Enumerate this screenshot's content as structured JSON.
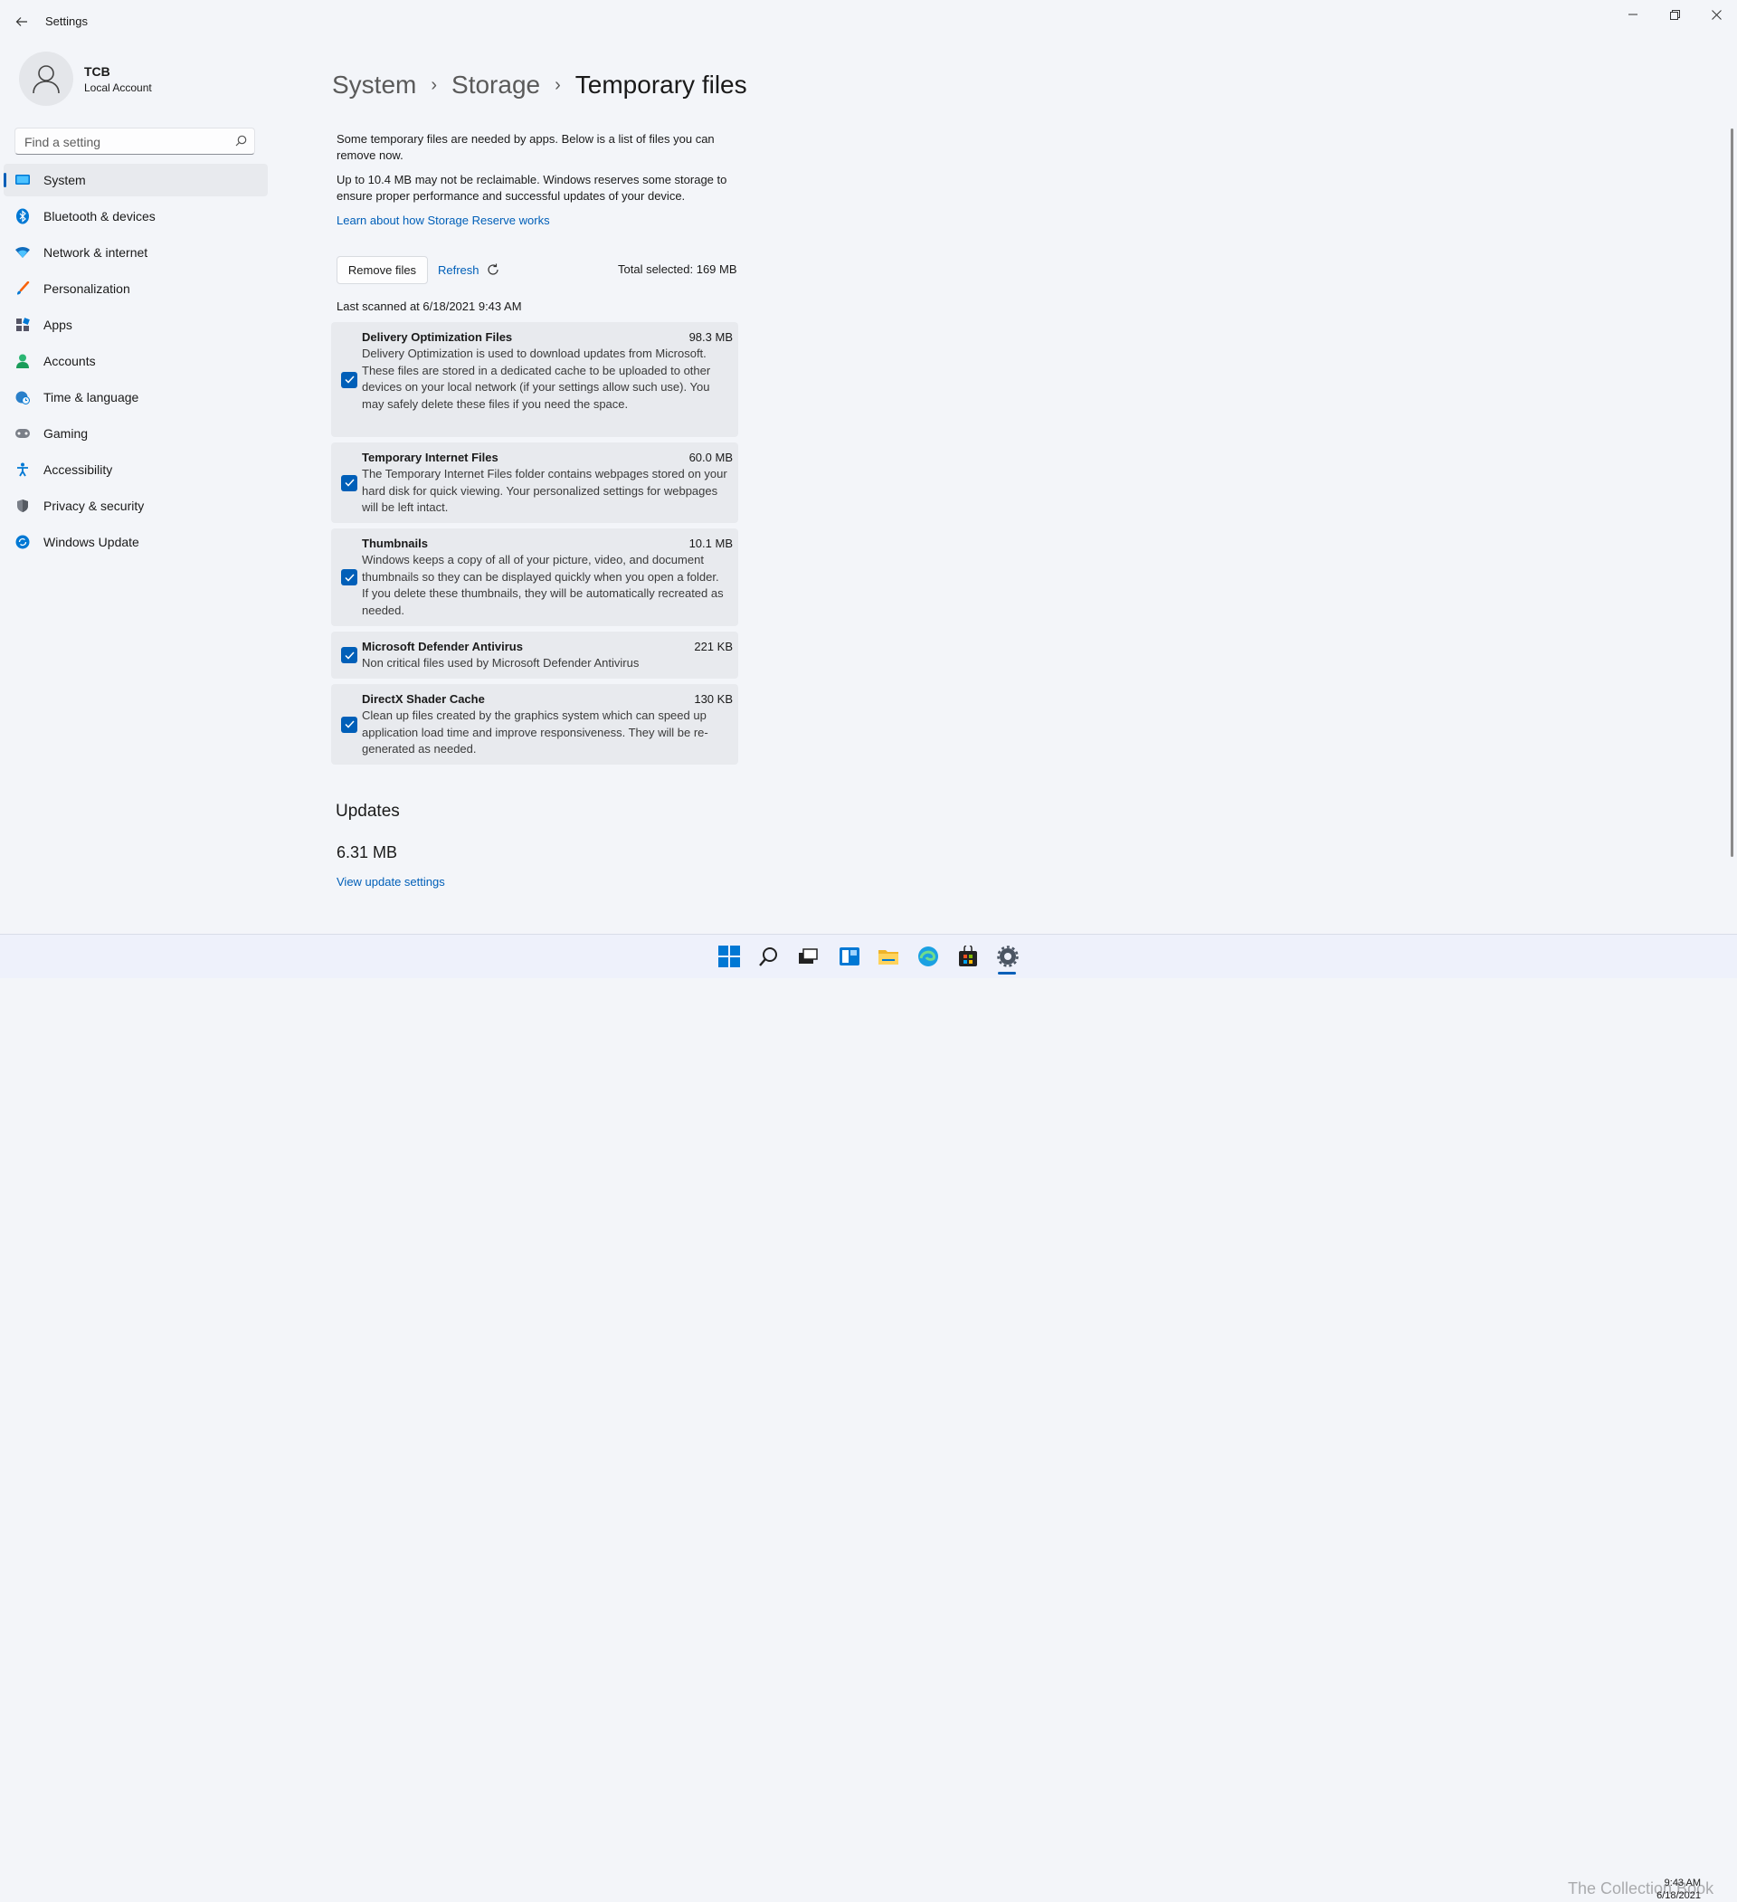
{
  "window": {
    "title": "Settings"
  },
  "profile": {
    "name": "TCB",
    "account_type": "Local Account"
  },
  "search": {
    "placeholder": "Find a setting"
  },
  "nav": {
    "items": [
      {
        "label": "System",
        "icon": "system-icon",
        "active": true
      },
      {
        "label": "Bluetooth & devices",
        "icon": "bluetooth-icon"
      },
      {
        "label": "Network & internet",
        "icon": "wifi-icon"
      },
      {
        "label": "Personalization",
        "icon": "brush-icon"
      },
      {
        "label": "Apps",
        "icon": "apps-icon"
      },
      {
        "label": "Accounts",
        "icon": "person-icon"
      },
      {
        "label": "Time & language",
        "icon": "globe-clock-icon"
      },
      {
        "label": "Gaming",
        "icon": "gamepad-icon"
      },
      {
        "label": "Accessibility",
        "icon": "accessibility-icon"
      },
      {
        "label": "Privacy & security",
        "icon": "shield-icon"
      },
      {
        "label": "Windows Update",
        "icon": "update-icon"
      }
    ]
  },
  "breadcrumb": {
    "items": [
      "System",
      "Storage",
      "Temporary files"
    ]
  },
  "content": {
    "intro": "Some temporary files are needed by apps. Below is a list of files you can remove now.",
    "reserve_note": "Up to 10.4 MB may not be reclaimable. Windows reserves some storage to ensure proper performance and successful updates of your device.",
    "learn_link": "Learn about how Storage Reserve works",
    "remove_button": "Remove files",
    "refresh_button": "Refresh",
    "total_selected": "Total selected: 169 MB",
    "last_scanned": "Last scanned at 6/18/2021 9:43 AM"
  },
  "files": [
    {
      "title": "Delivery Optimization Files",
      "size": "98.3 MB",
      "checked": true,
      "desc": "Delivery Optimization is used to download updates from Microsoft. These files are stored in a dedicated cache to be uploaded to other devices on your local network (if your settings allow such use). You may safely delete these files if you need the space."
    },
    {
      "title": "Temporary Internet Files",
      "size": "60.0 MB",
      "checked": true,
      "desc": "The Temporary Internet Files folder contains webpages stored on your hard disk for quick viewing. Your personalized settings for webpages will be left intact."
    },
    {
      "title": "Thumbnails",
      "size": "10.1 MB",
      "checked": true,
      "desc": "Windows keeps a copy of all of your picture, video, and document thumbnails so they can be displayed quickly when you open a folder. If you delete these thumbnails, they will be automatically recreated as needed."
    },
    {
      "title": "Microsoft Defender Antivirus",
      "size": "221 KB",
      "checked": true,
      "desc": "Non critical files used by Microsoft Defender Antivirus"
    },
    {
      "title": "DirectX Shader Cache",
      "size": "130 KB",
      "checked": true,
      "desc": "Clean up files created by the graphics system which can speed up application load time and improve responsiveness. They will be re-generated as needed."
    }
  ],
  "updates": {
    "heading": "Updates",
    "size": "6.31 MB",
    "link": "View update settings"
  },
  "taskbar": {
    "apps": [
      "start-icon",
      "search-icon",
      "task-view-icon",
      "widgets-icon",
      "file-explorer-icon",
      "edge-icon",
      "store-icon",
      "settings-icon"
    ],
    "time": "9:43 AM",
    "date": "6/18/2021",
    "watermark": "The Collection Book"
  },
  "colors": {
    "accent": "#005fb8",
    "background": "#f3f5f9",
    "card": "#e8eaee"
  }
}
